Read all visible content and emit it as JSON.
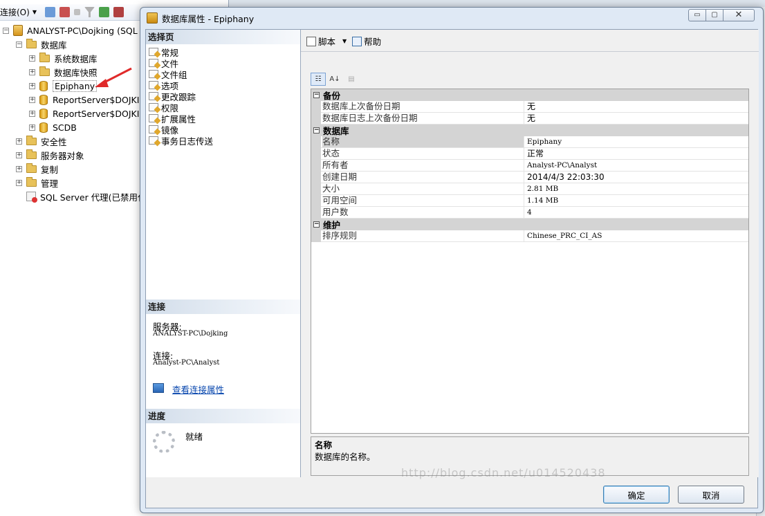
{
  "object_explorer": {
    "connect_label": "连接(O)",
    "tree": [
      {
        "label": "ANALYST-PC\\Dojking (SQL S",
        "level": 0,
        "expander": "⊟",
        "icon": "server-icon"
      },
      {
        "label": "数据库",
        "level": 1,
        "expander": "⊟",
        "icon": "folder-icon"
      },
      {
        "label": "系统数据库",
        "level": 2,
        "expander": "⊞",
        "icon": "folder-icon"
      },
      {
        "label": "数据库快照",
        "level": 2,
        "expander": "⊞",
        "icon": "folder-icon"
      },
      {
        "label": "Epiphany",
        "level": 2,
        "expander": "⊞",
        "icon": "database-icon"
      },
      {
        "label": "ReportServer$DOJKIN",
        "level": 2,
        "expander": "⊞",
        "icon": "database-icon"
      },
      {
        "label": "ReportServer$DOJKIN",
        "level": 2,
        "expander": "⊞",
        "icon": "database-icon"
      },
      {
        "label": "SCDB",
        "level": 2,
        "expander": "⊞",
        "icon": "database-icon"
      },
      {
        "label": "安全性",
        "level": 1,
        "expander": "⊞",
        "icon": "folder-icon"
      },
      {
        "label": "服务器对象",
        "level": 1,
        "expander": "⊞",
        "icon": "folder-icon"
      },
      {
        "label": "复制",
        "level": 1,
        "expander": "⊞",
        "icon": "folder-icon"
      },
      {
        "label": "管理",
        "level": 1,
        "expander": "⊞",
        "icon": "folder-icon"
      },
      {
        "label": "SQL Server 代理(已禁用代",
        "level": 1,
        "expander": "",
        "icon": "agent-icon"
      }
    ]
  },
  "dialog": {
    "title": "数据库属性 - Epiphany",
    "window_buttons": {
      "minimize": "▭",
      "maximize": "▢",
      "close": "✕"
    },
    "select_page": {
      "header": "选择页",
      "items": [
        "常规",
        "文件",
        "文件组",
        "选项",
        "更改跟踪",
        "权限",
        "扩展属性",
        "镜像",
        "事务日志传送"
      ]
    },
    "connection": {
      "header": "连接",
      "server_label": "服务器:",
      "server_value": "ANALYST-PC\\Dojking",
      "connection_label": "连接:",
      "connection_value": "Analyst-PC\\Analyst",
      "link": "查看连接属性"
    },
    "progress": {
      "header": "进度",
      "status": "就绪"
    },
    "toolbar": {
      "script_label": "脚本",
      "help_label": "帮助"
    },
    "property_grid": {
      "categories": [
        {
          "name": "备份",
          "rows": [
            {
              "name": "数据库上次备份日期",
              "value": "无",
              "mono": false
            },
            {
              "name": "数据库日志上次备份日期",
              "value": "无",
              "mono": false
            }
          ]
        },
        {
          "name": "数据库",
          "rows": [
            {
              "name": "名称",
              "value": "Epiphany",
              "mono": true
            },
            {
              "name": "状态",
              "value": "正常",
              "mono": false
            },
            {
              "name": "所有者",
              "value": "Analyst-PC\\Analyst",
              "mono": true
            },
            {
              "name": "创建日期",
              "value": "2014/4/3 22:03:30",
              "mono": false
            },
            {
              "name": "大小",
              "value": "2.81 MB",
              "mono": true
            },
            {
              "name": "可用空间",
              "value": "1.14 MB",
              "mono": true
            },
            {
              "name": "用户数",
              "value": "4",
              "mono": true
            }
          ]
        },
        {
          "name": "维护",
          "rows": [
            {
              "name": "排序规则",
              "value": "Chinese_PRC_CI_AS",
              "mono": true
            }
          ]
        }
      ]
    },
    "description": {
      "title": "名称",
      "text": "数据库的名称。"
    },
    "buttons": {
      "ok": "确定",
      "cancel": "取消"
    }
  },
  "watermark": "http://blog.csdn.net/u014520438",
  "colors": {
    "accent": "#3c7fb1",
    "link": "#0645ad",
    "annotation_arrow": "#e02a2a"
  }
}
